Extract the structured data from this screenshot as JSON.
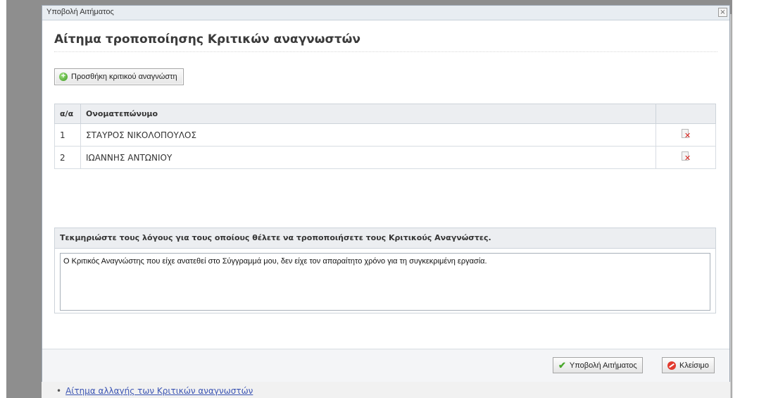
{
  "background": {
    "link_text": "Αίτημα αλλαγής των Κριτικών αναγνωστών"
  },
  "dialog": {
    "title": "Υποβολή Αιτήματος",
    "heading": "Αίτημα τροποποίησης Κριτικών αναγνωστών",
    "add_button_label": "Προσθήκη κριτικού αναγνώστη",
    "table": {
      "columns": [
        "α/α",
        "Ονοματεπώνυμο",
        ""
      ],
      "rows": [
        {
          "index": "1",
          "name": "ΣΤΑΥΡΟΣ ΝΙΚΟΛΟΠΟΥΛΟΣ"
        },
        {
          "index": "2",
          "name": "ΙΩΑΝΝΗΣ ΑΝΤΩΝΙΟΥ"
        }
      ]
    },
    "reason_label": "Τεκμηριώστε τους λόγους για τους οποίους θέλετε να τροποποιήσετε τους Κριτικούς Αναγνώστες.",
    "reason_value": "Ο Κριτικός Αναγνώστης που είχε ανατεθεί στο Σύγγραμμά μου, δεν είχε τον απαραίτητο χρόνο για τη συγκεκριμένη εργασία.",
    "submit_label": "Υποβολή Αιτήματος",
    "close_label": "Κλείσιμο"
  },
  "icons": {
    "add": "plus-circle-icon",
    "delete": "delete-icon",
    "submit": "checkmark-icon",
    "close": "stop-icon",
    "dialog_close": "close-icon"
  },
  "colors": {
    "header_bg": "#eceef1",
    "overlay": "#8e8e8e",
    "delete": "#d8251f",
    "check": "#4aa82c"
  }
}
